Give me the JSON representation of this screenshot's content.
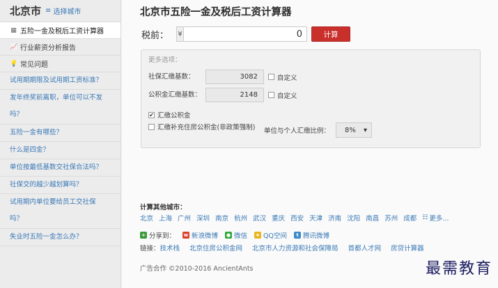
{
  "sidebar": {
    "city": "北京市",
    "switch_label": "选择城市",
    "menu": [
      {
        "icon": "calculator-icon",
        "label": "五险一金及税后工资计算器",
        "active": true
      },
      {
        "icon": "chart-icon",
        "label": "行业薪资分析报告",
        "active": false
      },
      {
        "icon": "bulb-icon",
        "label": "常见问题",
        "active": false
      }
    ],
    "faq": [
      "试用期期限及试用期工资标准？",
      "发年终奖前离职，单位可以不发吗？",
      "五险一金有哪些？",
      "什么是四金？",
      "单位按最低基数交社保合法吗？",
      "社保交的越少越划算吗？",
      "试用期内单位要给员工交社保吗？",
      "失业时五险一金怎么办？"
    ]
  },
  "main": {
    "title": "北京市五险一金及税后工资计算器",
    "salary_label": "税前：",
    "currency": "¥",
    "salary_value": "0",
    "calc_button": "计算",
    "options": {
      "title": "更多选项：",
      "social_base_label": "社保汇缴基数：",
      "social_base_value": "3082",
      "fund_base_label": "公积金汇缴基数：",
      "fund_base_value": "2148",
      "custom_label": "自定义",
      "pay_fund_label": "汇缴公积金",
      "pay_fund_checked": "✔",
      "supp_fund_label": "汇缴补充住房公积金(非政策强制)",
      "ratio_label": "单位与个人汇缴比例：",
      "ratio_value": "8%",
      "ratio_arrow": "▾"
    },
    "other_cities_title": "计算其他城市：",
    "cities": [
      "北京",
      "上海",
      "广州",
      "深圳",
      "南京",
      "杭州",
      "武汉",
      "重庆",
      "西安",
      "天津",
      "济南",
      "沈阳",
      "南昌",
      "苏州",
      "成都"
    ],
    "more_label": "更多...",
    "share_label": "分享到：",
    "share_items": [
      "新浪微博",
      "微信",
      "QQ空间",
      "腾讯微博"
    ],
    "links_label": "链接：",
    "links": [
      "技术栈",
      "北京住房公积金网",
      "北京市人力资源和社会保障局",
      "首都人才网",
      "房贷计算器"
    ],
    "copyright": "广告合作 ©2010-2016 AncientAnts"
  },
  "watermark": "最需教育"
}
